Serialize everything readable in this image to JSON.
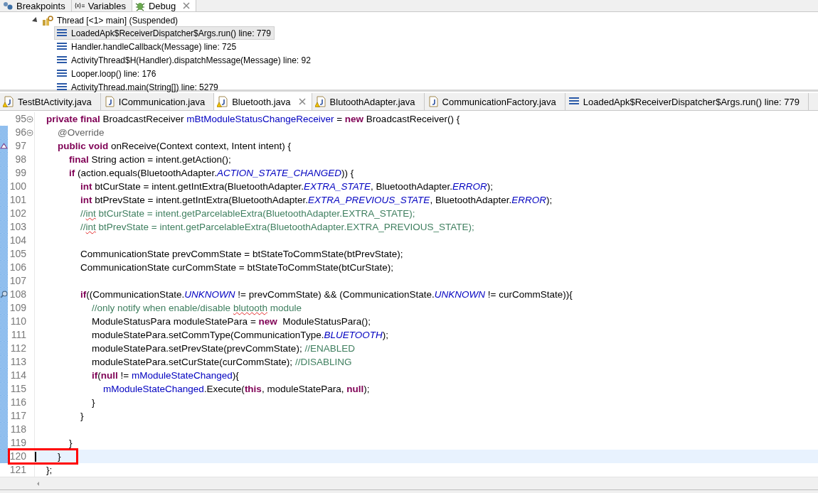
{
  "debug_view": {
    "tabs": [
      {
        "label": "Breakpoints",
        "kind": "breakpoints",
        "selected": false,
        "closable": false
      },
      {
        "label": "Variables",
        "kind": "variables",
        "selected": false,
        "closable": false
      },
      {
        "label": "Debug",
        "kind": "debug",
        "selected": true,
        "closable": true
      }
    ],
    "tree": {
      "label": "Thread [<1> main] (Suspended)",
      "expanded": true,
      "children": [
        {
          "label": "LoadedApk$ReceiverDispatcher$Args.run() line: 779",
          "selected": true
        },
        {
          "label": "Handler.handleCallback(Message) line: 725",
          "selected": false
        },
        {
          "label": "ActivityThread$H(Handler).dispatchMessage(Message) line: 92",
          "selected": false
        },
        {
          "label": "Looper.loop() line: 176",
          "selected": false
        },
        {
          "label": "ActivityThread.main(String[]) line: 5279",
          "selected": false
        }
      ]
    }
  },
  "editor": {
    "tabs": [
      {
        "label": "TestBtActivity.java",
        "kind": "java",
        "warning": true,
        "selected": false,
        "closable": false
      },
      {
        "label": "ICommunication.java",
        "kind": "java",
        "warning": false,
        "selected": false,
        "closable": false
      },
      {
        "label": "Bluetooth.java",
        "kind": "java",
        "warning": true,
        "selected": true,
        "closable": true
      },
      {
        "label": "BlutoothAdapter.java",
        "kind": "java",
        "warning": true,
        "selected": false,
        "closable": false
      },
      {
        "label": "CommunicationFactory.java",
        "kind": "java",
        "warning": false,
        "selected": false,
        "closable": false
      },
      {
        "label": "LoadedApk$ReceiverDispatcher$Args.run() line: 779",
        "kind": "frame",
        "warning": false,
        "selected": false,
        "closable": false
      }
    ],
    "lines": [
      {
        "number": "95",
        "kind": "fold",
        "scope": false,
        "current": false,
        "boxed": false,
        "code": [
          {
            "t": "private final",
            "kind": "kw"
          },
          {
            "t": " BroadcastReceiver ",
            "kind": "text"
          },
          {
            "t": "mBtModuleStatusChangeReceiver",
            "kind": "field"
          },
          {
            "t": " = ",
            "kind": "text"
          },
          {
            "t": "new",
            "kind": "kw"
          },
          {
            "t": " BroadcastReceiver() {",
            "kind": "text"
          }
        ],
        "children": [
          {
            "number": "96",
            "kind": "fold",
            "scope": true,
            "current": false,
            "boxed": false,
            "code": [
              {
                "t": "@Override",
                "kind": "ann"
              }
            ]
          },
          {
            "number": "97",
            "kind": "override",
            "scope": true,
            "current": false,
            "boxed": false,
            "code": [
              {
                "t": "public void",
                "kind": "kw"
              },
              {
                "t": " onReceive(Context context, Intent intent) {",
                "kind": "text"
              }
            ],
            "children": [
              {
                "number": "98",
                "kind": "plain",
                "scope": true,
                "current": false,
                "boxed": false,
                "code": [
                  {
                    "t": "final",
                    "kind": "kw"
                  },
                  {
                    "t": " String action = intent.getAction();",
                    "kind": "text"
                  }
                ]
              },
              {
                "number": "99",
                "kind": "plain",
                "scope": true,
                "current": false,
                "boxed": false,
                "code": [
                  {
                    "t": "if",
                    "kind": "kw"
                  },
                  {
                    "t": " (action.equals(BluetoothAdapter.",
                    "kind": "text"
                  },
                  {
                    "t": "ACTION_STATE_CHANGED",
                    "kind": "const"
                  },
                  {
                    "t": ")) {",
                    "kind": "text"
                  }
                ],
                "children": [
                  {
                    "number": "100",
                    "kind": "plain",
                    "scope": true,
                    "current": false,
                    "boxed": false,
                    "code": [
                      {
                        "t": "int",
                        "kind": "kw"
                      },
                      {
                        "t": " btCurState = intent.getIntExtra(BluetoothAdapter.",
                        "kind": "text"
                      },
                      {
                        "t": "EXTRA_STATE",
                        "kind": "const"
                      },
                      {
                        "t": ", BluetoothAdapter.",
                        "kind": "text"
                      },
                      {
                        "t": "ERROR",
                        "kind": "const"
                      },
                      {
                        "t": ");",
                        "kind": "text"
                      }
                    ]
                  },
                  {
                    "number": "101",
                    "kind": "plain",
                    "scope": true,
                    "current": false,
                    "boxed": false,
                    "code": [
                      {
                        "t": "int",
                        "kind": "kw"
                      },
                      {
                        "t": " btPrevState = intent.getIntExtra(BluetoothAdapter.",
                        "kind": "text"
                      },
                      {
                        "t": "EXTRA_PREVIOUS_STATE",
                        "kind": "const"
                      },
                      {
                        "t": ", BluetoothAdapter.",
                        "kind": "text"
                      },
                      {
                        "t": "ERROR",
                        "kind": "const"
                      },
                      {
                        "t": ");",
                        "kind": "text"
                      }
                    ]
                  },
                  {
                    "number": "102",
                    "kind": "plain",
                    "scope": true,
                    "current": false,
                    "boxed": false,
                    "code": [
                      {
                        "t": "//",
                        "kind": "comment"
                      },
                      {
                        "t": "int",
                        "kind": "typo"
                      },
                      {
                        "t": " btCurState = intent.getParcelableExtra(BluetoothAdapter.EXTRA_STATE);",
                        "kind": "comment"
                      }
                    ]
                  },
                  {
                    "number": "103",
                    "kind": "plain",
                    "scope": true,
                    "current": false,
                    "boxed": false,
                    "code": [
                      {
                        "t": "//",
                        "kind": "comment"
                      },
                      {
                        "t": "int",
                        "kind": "typo"
                      },
                      {
                        "t": " btPrevState = intent.getParcelableExtra(BluetoothAdapter.EXTRA_PREVIOUS_STATE);",
                        "kind": "comment"
                      }
                    ]
                  },
                  {
                    "number": "104",
                    "kind": "plain",
                    "scope": true,
                    "current": false,
                    "boxed": false
                  },
                  {
                    "number": "105",
                    "kind": "plain",
                    "scope": true,
                    "current": false,
                    "boxed": false,
                    "code": [
                      {
                        "t": "CommunicationState prevCommState = btStateToCommState(btPrevState);",
                        "kind": "text"
                      }
                    ]
                  },
                  {
                    "number": "106",
                    "kind": "plain",
                    "scope": true,
                    "current": false,
                    "boxed": false,
                    "code": [
                      {
                        "t": "CommunicationState curCommState = btStateToCommState(btCurState);",
                        "kind": "text"
                      }
                    ]
                  },
                  {
                    "number": "107",
                    "kind": "plain",
                    "scope": true,
                    "current": false,
                    "boxed": false
                  },
                  {
                    "number": "108",
                    "kind": "search",
                    "scope": true,
                    "current": false,
                    "boxed": false,
                    "code": [
                      {
                        "t": "if",
                        "kind": "kw"
                      },
                      {
                        "t": "((CommunicationState.",
                        "kind": "text"
                      },
                      {
                        "t": "UNKNOWN",
                        "kind": "const"
                      },
                      {
                        "t": " != prevCommState) && (CommunicationState.",
                        "kind": "text"
                      },
                      {
                        "t": "UNKNOWN",
                        "kind": "const"
                      },
                      {
                        "t": " != curCommState)){",
                        "kind": "text"
                      }
                    ],
                    "children": [
                      {
                        "number": "109",
                        "kind": "plain",
                        "scope": true,
                        "current": false,
                        "boxed": false,
                        "code": [
                          {
                            "t": "//only notify when enable/disable ",
                            "kind": "comment"
                          },
                          {
                            "t": "blutooth",
                            "kind": "typo"
                          },
                          {
                            "t": " module",
                            "kind": "comment"
                          }
                        ]
                      },
                      {
                        "number": "110",
                        "kind": "plain",
                        "scope": true,
                        "current": false,
                        "boxed": false,
                        "code": [
                          {
                            "t": "ModuleStatusPara moduleStatePara = ",
                            "kind": "text"
                          },
                          {
                            "t": "new",
                            "kind": "kw"
                          },
                          {
                            "t": "  ModuleStatusPara();",
                            "kind": "text"
                          }
                        ]
                      },
                      {
                        "number": "111",
                        "kind": "plain",
                        "scope": true,
                        "current": false,
                        "boxed": false,
                        "code": [
                          {
                            "t": "moduleStatePara.setCommType(CommunicationType.",
                            "kind": "text"
                          },
                          {
                            "t": "BLUETOOTH",
                            "kind": "const"
                          },
                          {
                            "t": ");",
                            "kind": "text"
                          }
                        ]
                      },
                      {
                        "number": "112",
                        "kind": "plain",
                        "scope": true,
                        "current": false,
                        "boxed": false,
                        "code": [
                          {
                            "t": "moduleStatePara.setPrevState(prevCommState); ",
                            "kind": "text"
                          },
                          {
                            "t": "//ENABLED",
                            "kind": "comment"
                          }
                        ]
                      },
                      {
                        "number": "113",
                        "kind": "plain",
                        "scope": true,
                        "current": false,
                        "boxed": false,
                        "code": [
                          {
                            "t": "moduleStatePara.setCurState(curCommState); ",
                            "kind": "text"
                          },
                          {
                            "t": "//DISABLING",
                            "kind": "comment"
                          }
                        ]
                      },
                      {
                        "number": "114",
                        "kind": "plain",
                        "scope": true,
                        "current": false,
                        "boxed": false,
                        "code": [
                          {
                            "t": "if",
                            "kind": "kw"
                          },
                          {
                            "t": "(",
                            "kind": "text"
                          },
                          {
                            "t": "null",
                            "kind": "kw"
                          },
                          {
                            "t": " != ",
                            "kind": "text"
                          },
                          {
                            "t": "mModuleStateChanged",
                            "kind": "field"
                          },
                          {
                            "t": "){",
                            "kind": "text"
                          }
                        ],
                        "children": [
                          {
                            "number": "115",
                            "kind": "plain",
                            "scope": true,
                            "current": false,
                            "boxed": false,
                            "code": [
                              {
                                "t": "mModuleStateChanged",
                                "kind": "field"
                              },
                              {
                                "t": ".Execute(",
                                "kind": "text"
                              },
                              {
                                "t": "this",
                                "kind": "kw"
                              },
                              {
                                "t": ", moduleStatePara, ",
                                "kind": "text"
                              },
                              {
                                "t": "null",
                                "kind": "kw"
                              },
                              {
                                "t": ");",
                                "kind": "text"
                              }
                            ]
                          }
                        ]
                      },
                      {
                        "number": "116",
                        "kind": "plain",
                        "scope": true,
                        "current": false,
                        "boxed": false,
                        "code": [
                          {
                            "t": "}",
                            "kind": "text"
                          }
                        ]
                      }
                    ]
                  },
                  {
                    "number": "117",
                    "kind": "plain",
                    "scope": true,
                    "current": false,
                    "boxed": false,
                    "code": [
                      {
                        "t": "}",
                        "kind": "text"
                      }
                    ]
                  },
                  {
                    "number": "118",
                    "kind": "plain",
                    "scope": true,
                    "current": false,
                    "boxed": false
                  }
                ]
              },
              {
                "number": "119",
                "kind": "plain",
                "scope": true,
                "current": false,
                "boxed": false,
                "code": [
                  {
                    "t": "}",
                    "kind": "text"
                  }
                ]
              }
            ]
          },
          {
            "number": "120",
            "kind": "plain",
            "scope": true,
            "current": true,
            "boxed": true,
            "code": [
              {
                "t": "}",
                "kind": "text"
              }
            ]
          }
        ]
      },
      {
        "number": "121",
        "kind": "plain",
        "scope": false,
        "current": false,
        "boxed": false,
        "code": [
          {
            "t": "};",
            "kind": "text"
          }
        ]
      }
    ]
  }
}
